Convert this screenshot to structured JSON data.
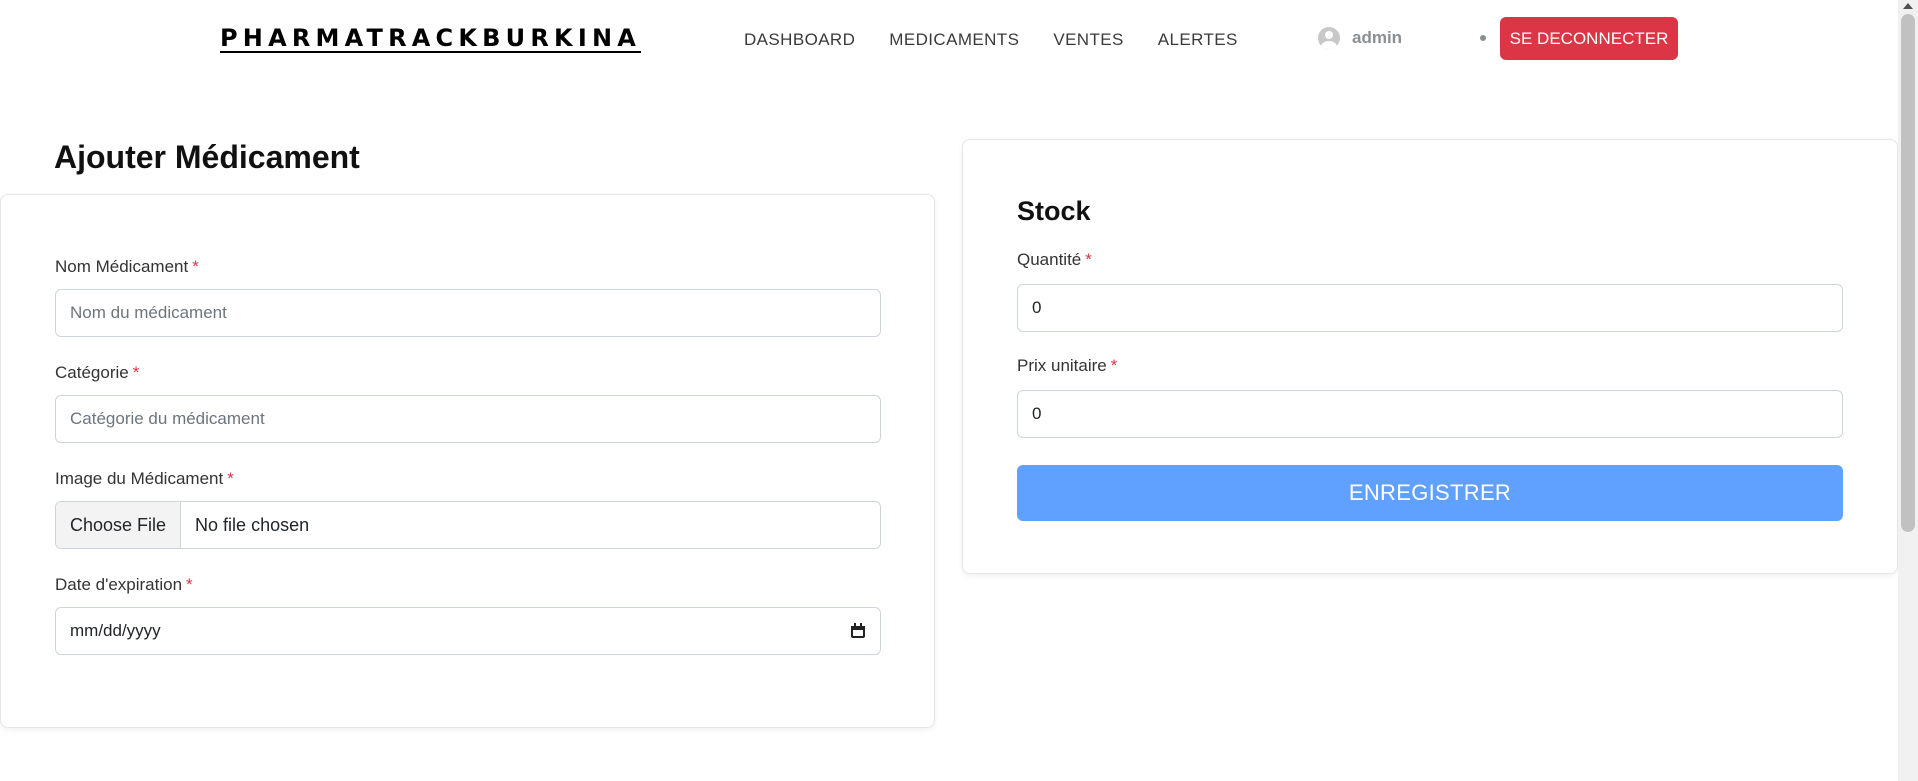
{
  "app": {
    "brand": "PHARMATRACKBURKINA"
  },
  "nav": {
    "links": [
      "DASHBOARD",
      "MEDICAMENTS",
      "VENTES",
      "ALERTES"
    ]
  },
  "user": {
    "name": "admin",
    "logout_label": "SE DECONNECTER",
    "icon": "user-avatar-icon"
  },
  "page": {
    "title": "Ajouter Médicament"
  },
  "form": {
    "required_marker": "*",
    "name": {
      "label": "Nom Médicament",
      "placeholder": "Nom du médicament",
      "value": ""
    },
    "category": {
      "label": "Catégorie",
      "placeholder": "Catégorie du médicament",
      "value": ""
    },
    "image": {
      "label": "Image du Médicament",
      "button_label": "Choose File",
      "status": "No file chosen"
    },
    "expiry": {
      "label": "Date d'expiration",
      "value": "mm/dd/yyyy"
    }
  },
  "stock": {
    "title": "Stock",
    "quantity": {
      "label": "Quantité",
      "value": "0"
    },
    "unit_price": {
      "label": "Prix unitaire",
      "value": "0"
    },
    "save_label": "ENREGISTRER"
  },
  "colors": {
    "danger": "#dc3545",
    "primary_button": "#60a0ff",
    "border": "#ced4da"
  }
}
